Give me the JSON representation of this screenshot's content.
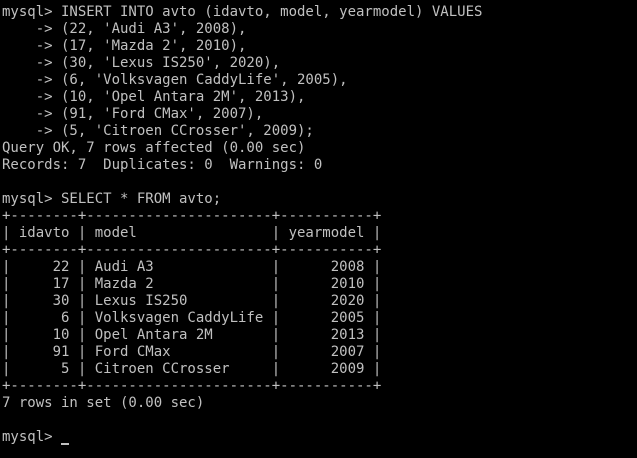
{
  "terminal": {
    "colors": {
      "background": "#000000",
      "foreground": "#c0c0c0"
    },
    "lines": [
      "mysql> INSERT INTO avto (idavto, model, yearmodel) VALUES",
      "    -> (22, 'Audi A3', 2008),",
      "    -> (17, 'Mazda 2', 2010),",
      "    -> (30, 'Lexus IS250', 2020),",
      "    -> (6, 'Volksvagen CaddyLife', 2005),",
      "    -> (10, 'Opel Antara 2M', 2013),",
      "    -> (91, 'Ford CMax', 2007),",
      "    -> (5, 'Citroen CCrosser', 2009);",
      "Query OK, 7 rows affected (0.00 sec)",
      "Records: 7  Duplicates: 0  Warnings: 0",
      "",
      "mysql> SELECT * FROM avto;",
      "+--------+----------------------+-----------+",
      "| idavto | model                | yearmodel |",
      "+--------+----------------------+-----------+",
      "|     22 | Audi A3              |      2008 |",
      "|     17 | Mazda 2              |      2010 |",
      "|     30 | Lexus IS250          |      2020 |",
      "|      6 | Volksvagen CaddyLife |      2005 |",
      "|     10 | Opel Antara 2M       |      2013 |",
      "|     91 | Ford CMax            |      2007 |",
      "|      5 | Citroen CCrosser     |      2009 |",
      "+--------+----------------------+-----------+",
      "7 rows in set (0.00 sec)",
      "",
      "mysql> "
    ]
  }
}
